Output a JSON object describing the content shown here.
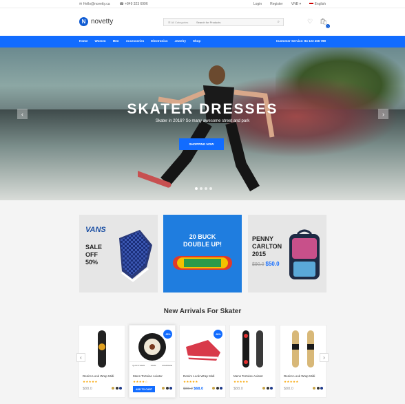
{
  "topbar": {
    "email": "Hello@novetty.ca",
    "phone": "+849 323 6996",
    "login": "Login",
    "register": "Register",
    "currency": "VNĐ ▾",
    "language": "English"
  },
  "header": {
    "logo_text": "novetty",
    "category_select": "All Categories",
    "search_placeholder": "Search for Products",
    "cart_count": "0"
  },
  "nav": {
    "items": [
      "Home",
      "Women",
      "Men",
      "Accessories",
      "Electronics",
      "Jewelry",
      "Shop"
    ],
    "customer_service": "Customer Service: 84 123 456 789"
  },
  "hero": {
    "title": "SKATER DRESSES",
    "subtitle": "Skater in 2016? So many awesome street and park",
    "cta": "SHOPPING NOW",
    "prev": "‹",
    "next": "›"
  },
  "promos": {
    "vans": {
      "brand": "VANS",
      "line1": "SALE",
      "line2": "OFF",
      "line3": "50%"
    },
    "buck": {
      "line1": "20 BUCK",
      "line2": "DOUBLE UP!"
    },
    "penny": {
      "line1": "PENNY",
      "line2": "CARLTON",
      "line3": "2015",
      "old_price": "$90.0",
      "new_price": "$50.0"
    }
  },
  "arrivals": {
    "title": "New Arrivals For Skater",
    "products": [
      {
        "name": "Denim Look Wrap Midi",
        "stars": "★★★★★",
        "price": "$88.0",
        "old_price": "",
        "sale": ""
      },
      {
        "name": "Mens Tortoise Aviator",
        "stars": "★★★★☆",
        "price": "",
        "old_price": "",
        "sale": "-25%",
        "add_to_cart": "ADD TO CART",
        "quick_view": "QUICK VIEW",
        "save": "SAVE",
        "compare": "COMPARE"
      },
      {
        "name": "Denim Look Wrap Midi",
        "stars": "★★★★★",
        "price": "$68.0",
        "old_price": "$88.0",
        "sale": "-30%"
      },
      {
        "name": "Mens Tortoise Aviator",
        "stars": "★★★★★",
        "price": "$88.0",
        "old_price": "",
        "sale": ""
      },
      {
        "name": "Denim Look Wrap Midi",
        "stars": "★★★★★",
        "price": "$88.0",
        "old_price": "",
        "sale": ""
      }
    ],
    "prev": "‹",
    "next": "›"
  },
  "colors": {
    "accent": "#126cff",
    "promo_blue": "#1f7ddf",
    "star": "#f7a400"
  }
}
